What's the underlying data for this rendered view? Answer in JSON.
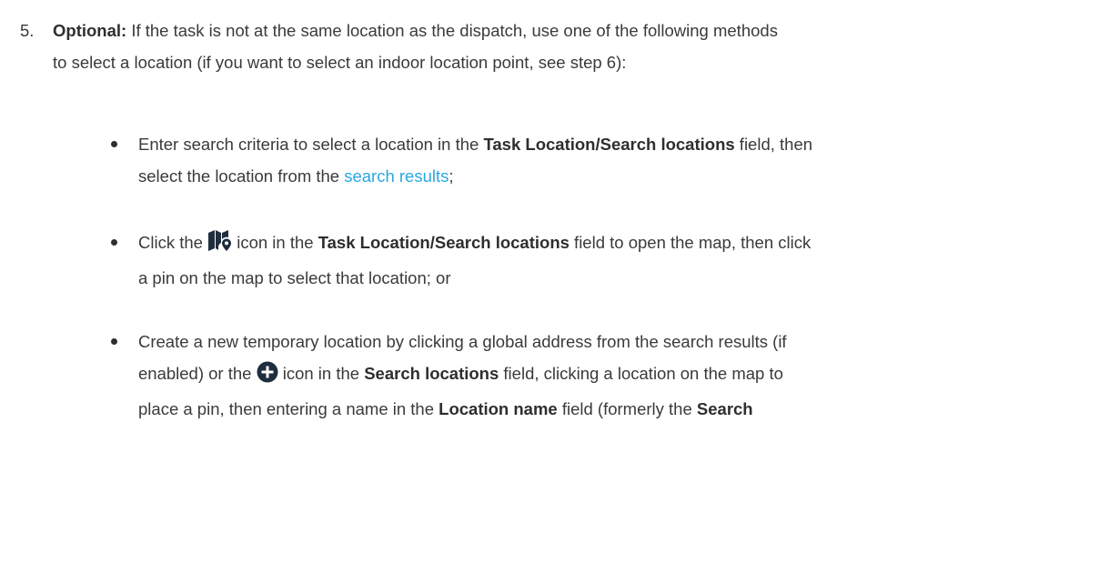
{
  "step5": {
    "number": "5.",
    "optional_label": "Optional:",
    "text_1": " If the task is not at the same location as the dispatch, use one of the following methods",
    "text_2": "to select a location (if you want to select an indoor location point, see step 6):"
  },
  "bullets": [
    {
      "t1": "Enter search criteria to select a location in the ",
      "b1": "Task Location",
      "t2": "/",
      "b2": "Search locations",
      "t3": " field, then",
      "t4": "select the location from the ",
      "link": "search results",
      "t5": ";"
    },
    {
      "t1": "Click the ",
      "icon": "map-pin-icon",
      "t2": " icon in the ",
      "b1": "Task Location",
      "t3": "/",
      "b2": "Search locations",
      "t4": " field to open the map, then click",
      "t5": "a pin on the map to select that location; or"
    },
    {
      "t1": "Create a new temporary location by clicking a global address from the search results (if",
      "t2": "enabled) or the ",
      "icon": "plus-circle-icon",
      "t3": " icon in the ",
      "b1": "Search locations",
      "t4": " field, clicking a location on the map to",
      "t5": "place a pin, then entering a name in the ",
      "b2": "Location name",
      "t6": " field (formerly the ",
      "b3": "Search"
    }
  ],
  "colors": {
    "text": "#3a3a3a",
    "link": "#29a8e0",
    "icon": "#1f2d3d"
  }
}
